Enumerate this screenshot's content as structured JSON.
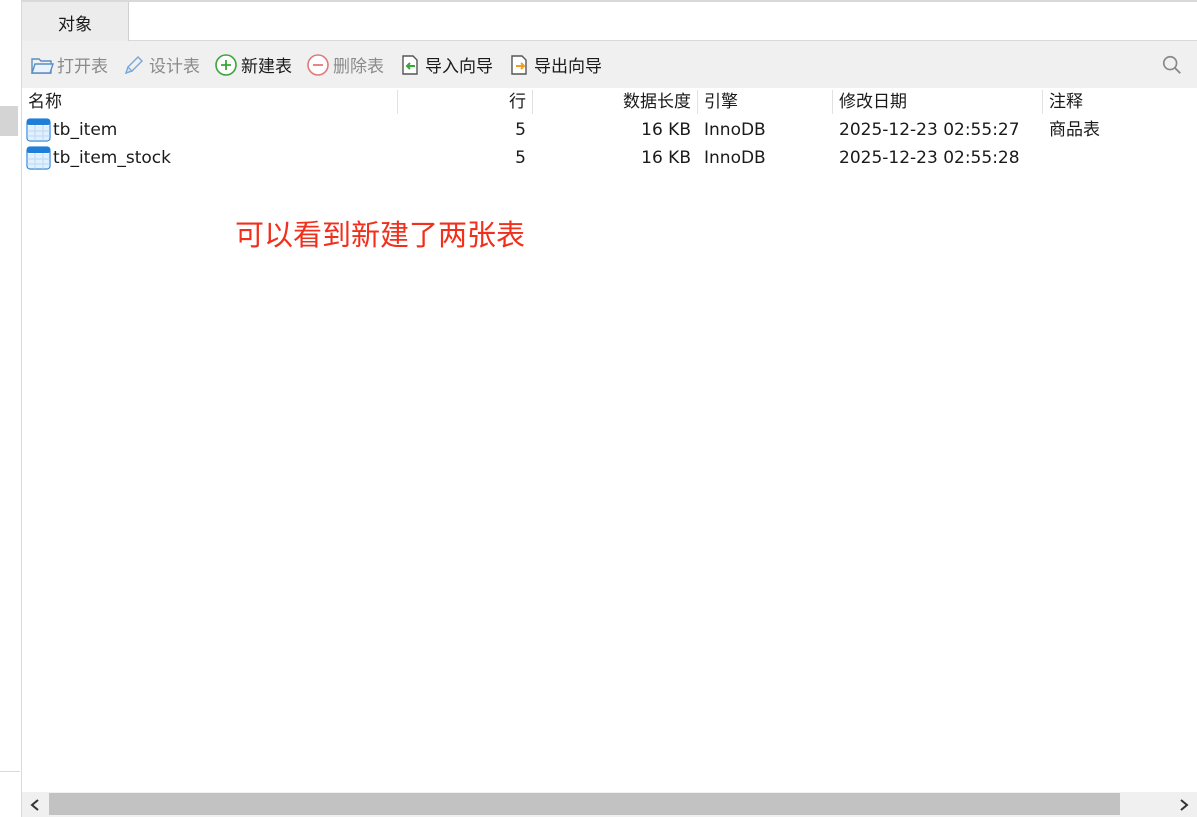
{
  "tabs": [
    {
      "label": "对象"
    }
  ],
  "toolbar": {
    "open_table": "打开表",
    "design_table": "设计表",
    "new_table": "新建表",
    "delete_table": "删除表",
    "import_wizard": "导入向导",
    "export_wizard": "导出向导"
  },
  "table": {
    "columns": [
      "名称",
      "行",
      "数据长度",
      "引擎",
      "修改日期",
      "注释"
    ],
    "rows": [
      {
        "name": "tb_item",
        "rows": "5",
        "data_length": "16 KB",
        "engine": "InnoDB",
        "modified": "2025-12-23 02:55:27",
        "comment": "商品表"
      },
      {
        "name": "tb_item_stock",
        "rows": "5",
        "data_length": "16 KB",
        "engine": "InnoDB",
        "modified": "2025-12-23 02:55:28",
        "comment": ""
      }
    ]
  },
  "annotation": "可以看到新建了两张表",
  "colors": {
    "annotation": "#f0301c",
    "toolbar_bg": "#f0f0f0",
    "tab_active_bg": "#ececec",
    "new_icon": "#3aa53a",
    "delete_icon": "#e07a7a"
  },
  "icons": {
    "open_table": "folder-icon",
    "design_table": "pencil-icon",
    "new_table": "plus-circle-icon",
    "delete_table": "minus-circle-icon",
    "import_wizard": "import-icon",
    "export_wizard": "export-icon",
    "search": "search-icon",
    "table": "table-icon"
  }
}
